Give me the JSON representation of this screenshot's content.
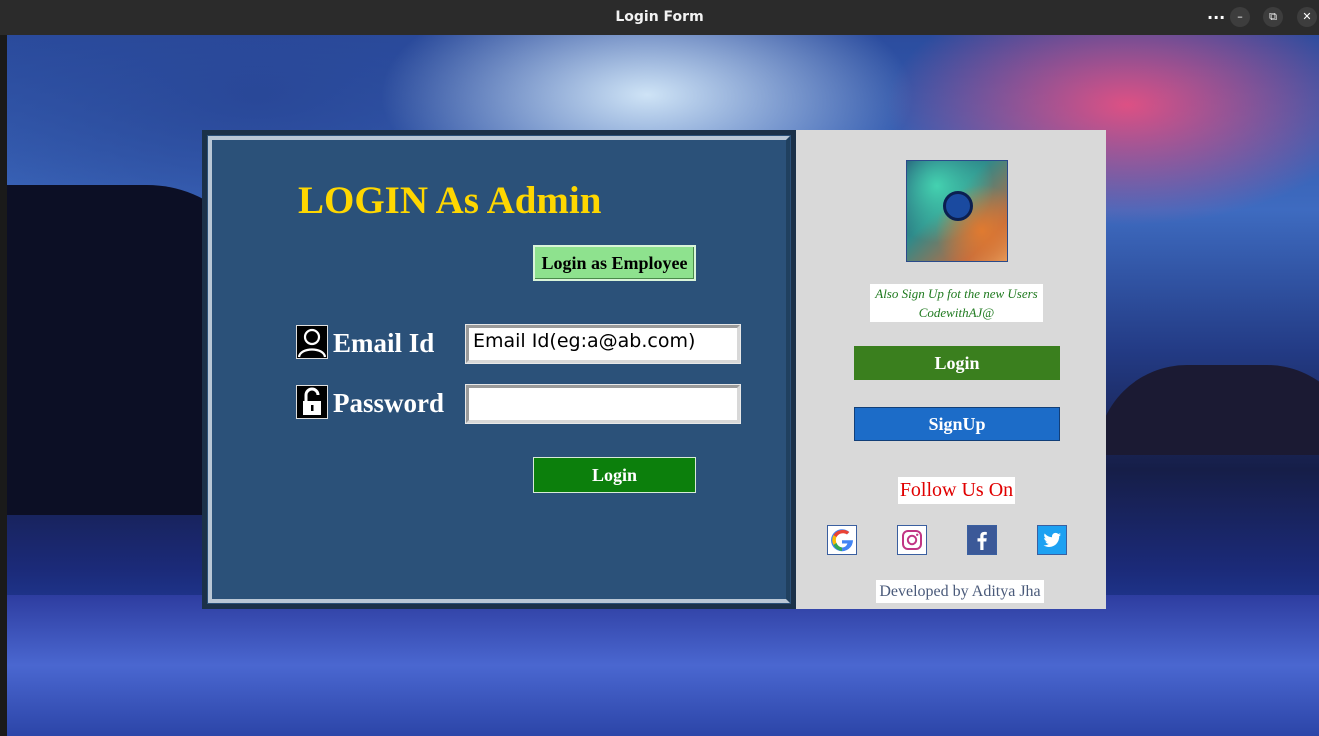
{
  "window": {
    "title": "Login Form",
    "controls": {
      "more": "...",
      "minimize": "–",
      "maximize": "⧉",
      "close": "✕"
    }
  },
  "admin": {
    "title": "LOGIN As Admin",
    "employee_button": "Login as Employee",
    "email_label": "Email Id",
    "email_value": "Email Id(eg:a@ab.com)",
    "password_label": "Password",
    "password_value": "",
    "login_button": "Login"
  },
  "sidebar": {
    "signup_note_line1": "Also Sign Up fot the new Users",
    "signup_note_line2": "CodewithAJ@",
    "login_button": "Login",
    "signup_button": "SignUp",
    "follow_label": "Follow Us On",
    "social_icons": [
      "google-icon",
      "instagram-icon",
      "facebook-icon",
      "twitter-icon"
    ],
    "credit": "Developed by Aditya Jha"
  },
  "colors": {
    "admin_bg": "#2b5179",
    "title_yellow": "#ffd700",
    "employee_btn": "#8ee28e",
    "admin_login_btn": "#0c7f0c",
    "side_login_btn": "#3a7f1e",
    "side_signup_btn": "#1c6cc8",
    "follow_red": "#e00000",
    "sidebar_bg": "#d9d9d9"
  }
}
